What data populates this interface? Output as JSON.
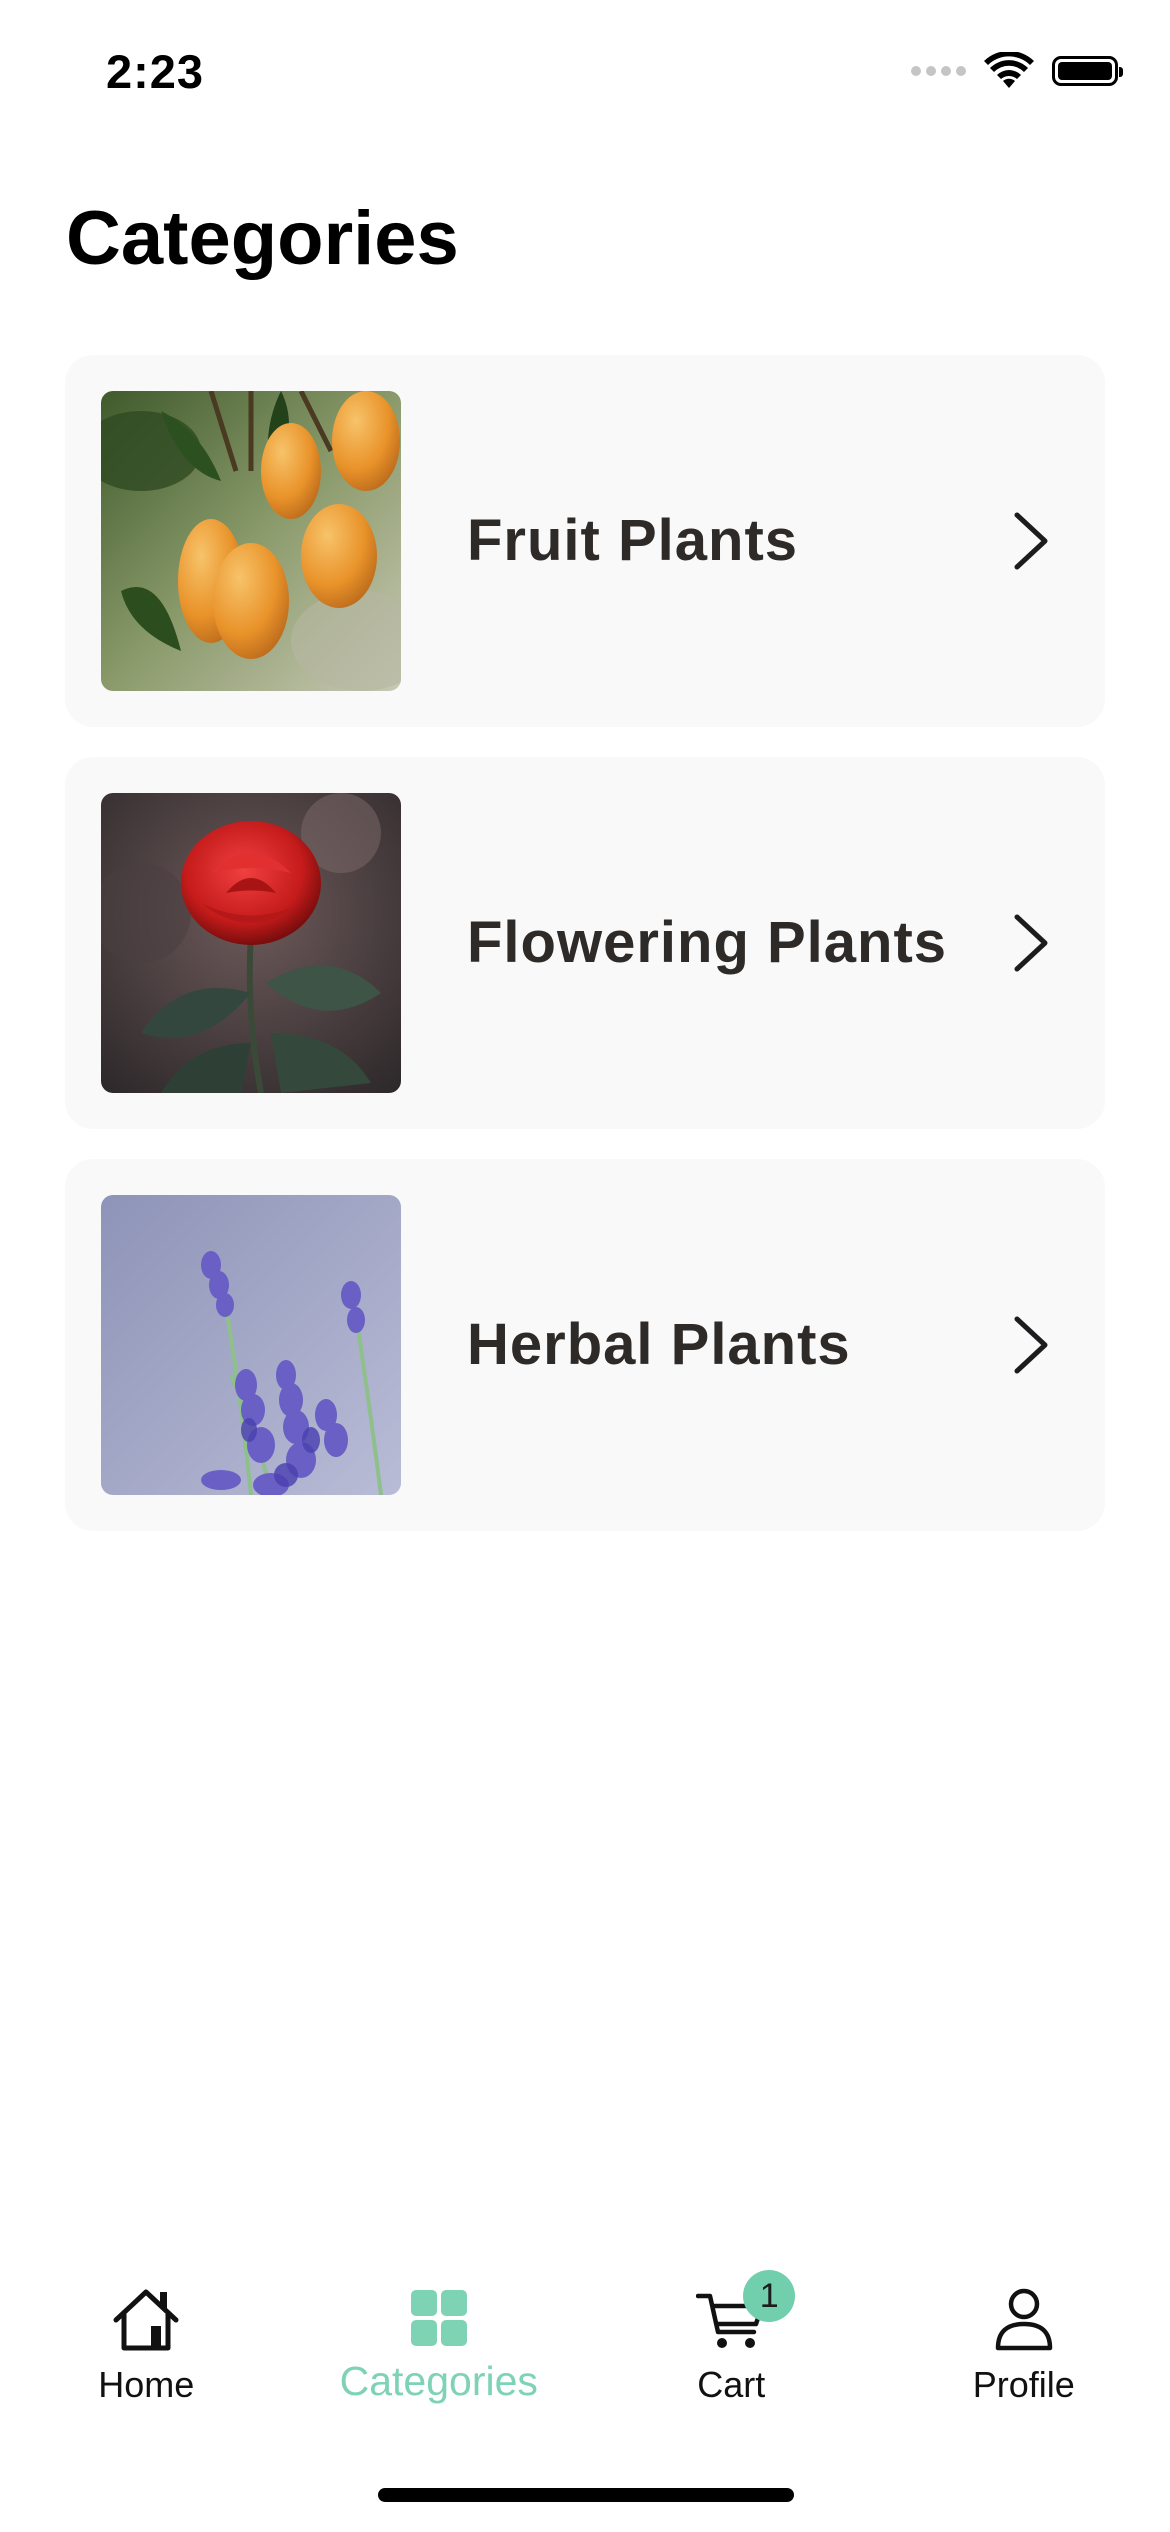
{
  "status_bar": {
    "time": "2:23"
  },
  "page": {
    "title": "Categories"
  },
  "categories": [
    {
      "label": "Fruit Plants",
      "image_icon": "mango-tree-photo"
    },
    {
      "label": "Flowering Plants",
      "image_icon": "red-rose-photo"
    },
    {
      "label": "Herbal Plants",
      "image_icon": "lavender-photo"
    }
  ],
  "tab_bar": {
    "tabs": [
      {
        "label": "Home",
        "icon": "home-icon",
        "active": false
      },
      {
        "label": "Categories",
        "icon": "grid-icon",
        "active": true
      },
      {
        "label": "Cart",
        "icon": "cart-icon",
        "active": false,
        "badge": "1"
      },
      {
        "label": "Profile",
        "icon": "person-icon",
        "active": false
      }
    ]
  },
  "colors": {
    "accent": "#7fd3b5",
    "badge": "#71cfae",
    "card_background": "#f9f9f9",
    "label_text": "#2e2a28"
  }
}
